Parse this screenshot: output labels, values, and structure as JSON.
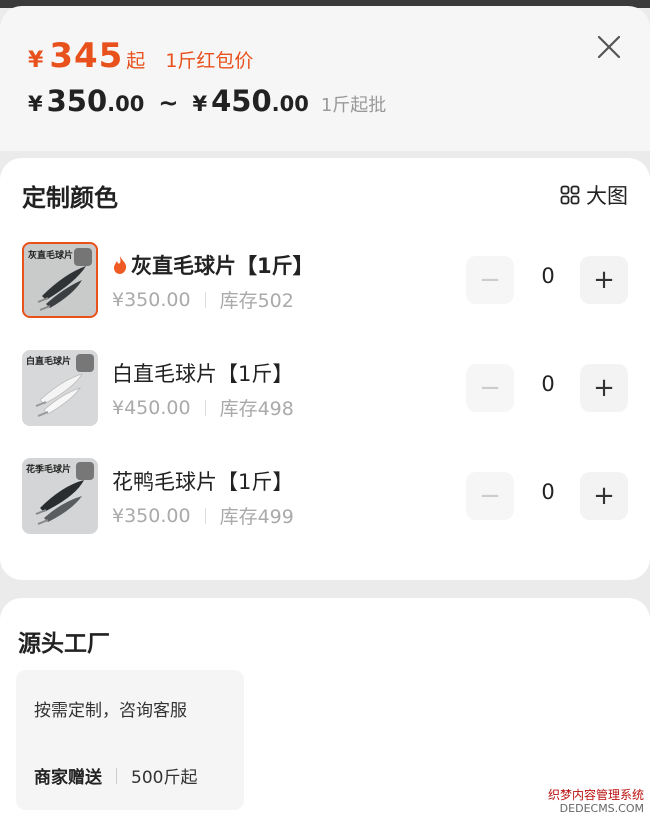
{
  "price": {
    "yen": "¥",
    "main": "345",
    "suffix": "起",
    "note": "1斤红包价"
  },
  "range": {
    "yen1": "¥",
    "low_int": "350",
    "low_dec": ".00",
    "tilde": "~",
    "yen2": "¥",
    "high_int": "450",
    "high_dec": ".00",
    "note": "1斤起批"
  },
  "section_color": {
    "title": "定制颜色",
    "big_view": "大图"
  },
  "items": [
    {
      "thumb_label": "灰直毛球片",
      "name": "灰直毛球片【1斤】",
      "price": "¥350.00",
      "stock": "库存502",
      "qty": "0",
      "hot": true
    },
    {
      "thumb_label": "白直毛球片",
      "name": "白直毛球片【1斤】",
      "price": "¥450.00",
      "stock": "库存498",
      "qty": "0",
      "hot": false
    },
    {
      "thumb_label": "花季毛球片",
      "name": "花鸭毛球片【1斤】",
      "price": "¥350.00",
      "stock": "库存499",
      "qty": "0",
      "hot": false
    }
  ],
  "stepper": {
    "minus": "−",
    "plus": "+"
  },
  "factory": {
    "title": "源头工厂",
    "desc": "按需定制，咨询客服",
    "gift_label": "商家赠送",
    "gift_value": "500斤起"
  },
  "watermark": {
    "line1": "织梦内容管理系统",
    "line2": "DEDECMS.COM"
  },
  "colors": {
    "accent": "#e8501c"
  }
}
